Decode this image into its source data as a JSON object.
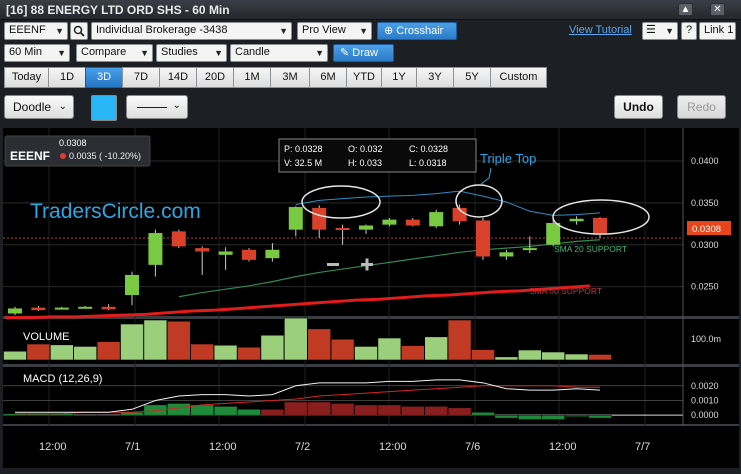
{
  "window": {
    "title": "[16] 88 ENERGY LTD ORD SHS - 60 Min",
    "buttons": [
      "▲",
      "✕"
    ]
  },
  "toolbar1": {
    "symbol": "EEENF",
    "account": "Individual Brokerage -3438",
    "view": "Pro View",
    "crosshair_label": "Crosshair",
    "tutorial_link": "View Tutorial",
    "help_label": "?",
    "link_label": "Link 1"
  },
  "toolbar2": {
    "interval": "60 Min",
    "compare": "Compare",
    "studies": "Studies",
    "chart_type": "Candle",
    "draw_label": "Draw"
  },
  "periods": [
    "Today",
    "1D",
    "3D",
    "7D",
    "14D",
    "20D",
    "1M",
    "3M",
    "6M",
    "YTD",
    "1Y",
    "3Y",
    "5Y",
    "Custom"
  ],
  "active_period": "3D",
  "drawing": {
    "tool": "Doodle",
    "color": "#29b6f6",
    "undo": "Undo",
    "redo": "Redo"
  },
  "quote": {
    "symbol": "EEENF",
    "last": "0.0308",
    "change": "0.0035 ( -10.20%)",
    "change_color": "#e53935"
  },
  "ohlc": {
    "p": "P: 0.0328",
    "o": "O: 0.032",
    "c": "C: 0.0328",
    "v": "V: 32.5 M",
    "h": "H: 0.033",
    "l": "L: 0.0318"
  },
  "annotations": {
    "watermark": "TradersCircle.com",
    "triple_top": "Triple Top",
    "sma20": "SMA 20 SUPPORT",
    "sma50": "SMA 50 SUPPORT",
    "price_tag": "0.0308"
  },
  "panels": {
    "volume_label": "VOLUME",
    "macd_label": "MACD (12,26,9)"
  },
  "chart_data": {
    "type": "candlestick",
    "price_axis": {
      "ticks": [
        "0.0400",
        "0.0350",
        "0.0300",
        "0.0250"
      ],
      "range": [
        0.0215,
        0.0425
      ]
    },
    "time_axis": {
      "ticks": [
        "12:00",
        "7/1",
        "12:00",
        "7/2",
        "12:00",
        "7/6",
        "12:00",
        "7/7"
      ]
    },
    "volume_axis": {
      "ticks": [
        "100.0m"
      ]
    },
    "macd_axis": {
      "ticks": [
        "0.0020",
        "0.0010",
        "0.0000"
      ],
      "range": [
        -0.0006,
        0.0028
      ]
    },
    "candles": [
      {
        "o": 0.0218,
        "h": 0.0226,
        "l": 0.0216,
        "c": 0.0224
      },
      {
        "o": 0.0225,
        "h": 0.0227,
        "l": 0.0221,
        "c": 0.0222
      },
      {
        "o": 0.0224,
        "h": 0.0226,
        "l": 0.0223,
        "c": 0.0225
      },
      {
        "o": 0.0225,
        "h": 0.0227,
        "l": 0.0224,
        "c": 0.0226
      },
      {
        "o": 0.0226,
        "h": 0.0229,
        "l": 0.0222,
        "c": 0.0223
      },
      {
        "o": 0.024,
        "h": 0.0268,
        "l": 0.0228,
        "c": 0.0264
      },
      {
        "o": 0.0276,
        "h": 0.0318,
        "l": 0.0262,
        "c": 0.0314
      },
      {
        "o": 0.0316,
        "h": 0.0318,
        "l": 0.0296,
        "c": 0.0298
      },
      {
        "o": 0.0296,
        "h": 0.0298,
        "l": 0.0264,
        "c": 0.0292
      },
      {
        "o": 0.0288,
        "h": 0.0297,
        "l": 0.027,
        "c": 0.0292
      },
      {
        "o": 0.0294,
        "h": 0.0296,
        "l": 0.028,
        "c": 0.0282
      },
      {
        "o": 0.0284,
        "h": 0.0302,
        "l": 0.028,
        "c": 0.0294
      },
      {
        "o": 0.0318,
        "h": 0.0346,
        "l": 0.031,
        "c": 0.0345
      },
      {
        "o": 0.0344,
        "h": 0.0347,
        "l": 0.0308,
        "c": 0.0318
      },
      {
        "o": 0.032,
        "h": 0.0324,
        "l": 0.03,
        "c": 0.0318
      },
      {
        "o": 0.0318,
        "h": 0.0324,
        "l": 0.0313,
        "c": 0.0323
      },
      {
        "o": 0.0324,
        "h": 0.0332,
        "l": 0.0322,
        "c": 0.033
      },
      {
        "o": 0.033,
        "h": 0.0332,
        "l": 0.0322,
        "c": 0.0323
      },
      {
        "o": 0.0322,
        "h": 0.0342,
        "l": 0.032,
        "c": 0.0339
      },
      {
        "o": 0.0344,
        "h": 0.0348,
        "l": 0.0324,
        "c": 0.0328
      },
      {
        "o": 0.0329,
        "h": 0.0332,
        "l": 0.0282,
        "c": 0.0286
      },
      {
        "o": 0.0286,
        "h": 0.0294,
        "l": 0.0282,
        "c": 0.0291
      },
      {
        "o": 0.0294,
        "h": 0.031,
        "l": 0.029,
        "c": 0.0296
      },
      {
        "o": 0.03,
        "h": 0.0332,
        "l": 0.0298,
        "c": 0.0326
      },
      {
        "o": 0.0328,
        "h": 0.0334,
        "l": 0.0324,
        "c": 0.0331
      },
      {
        "o": 0.0332,
        "h": 0.0333,
        "l": 0.0308,
        "c": 0.0312
      }
    ],
    "volume": [
      {
        "v": 0.22,
        "up": true
      },
      {
        "v": 0.4,
        "up": false
      },
      {
        "v": 0.38,
        "up": true
      },
      {
        "v": 0.34,
        "up": true
      },
      {
        "v": 0.46,
        "up": false
      },
      {
        "v": 0.9,
        "up": true
      },
      {
        "v": 1.0,
        "up": true
      },
      {
        "v": 0.97,
        "up": false
      },
      {
        "v": 0.4,
        "up": false
      },
      {
        "v": 0.37,
        "up": true
      },
      {
        "v": 0.32,
        "up": false
      },
      {
        "v": 0.62,
        "up": true
      },
      {
        "v": 1.05,
        "up": true
      },
      {
        "v": 0.78,
        "up": false
      },
      {
        "v": 0.52,
        "up": false
      },
      {
        "v": 0.34,
        "up": true
      },
      {
        "v": 0.55,
        "up": true
      },
      {
        "v": 0.36,
        "up": false
      },
      {
        "v": 0.58,
        "up": true
      },
      {
        "v": 1.0,
        "up": false
      },
      {
        "v": 0.26,
        "up": false
      },
      {
        "v": 0.08,
        "up": true
      },
      {
        "v": 0.25,
        "up": true
      },
      {
        "v": 0.2,
        "up": true
      },
      {
        "v": 0.15,
        "up": true
      },
      {
        "v": 0.14,
        "up": false
      }
    ],
    "sma20": [
      null,
      null,
      null,
      null,
      null,
      null,
      null,
      0.0238,
      0.0243,
      0.0247,
      0.0251,
      0.0256,
      0.0262,
      0.0267,
      0.0271,
      0.0275,
      0.0279,
      0.0283,
      0.0287,
      0.0291,
      0.0294,
      0.0296,
      0.0298,
      0.0301,
      0.0304,
      0.0306
    ],
    "sma50": [
      0.0213,
      0.0213,
      0.0214,
      0.0214,
      0.0215,
      0.0216,
      0.0217,
      0.0219,
      0.0221,
      0.0222,
      0.0224,
      0.0226,
      0.0228,
      0.023,
      0.0232,
      0.0234,
      0.0235,
      0.0237,
      0.0239,
      0.024,
      0.0242,
      0.0244,
      0.0245,
      0.0247,
      0.0249,
      0.0251
    ],
    "bbands_upper": [
      null,
      null,
      null,
      null,
      null,
      null,
      null,
      null,
      null,
      null,
      null,
      null,
      0.0348,
      0.0353,
      0.0355,
      0.0357,
      0.0358,
      0.0359,
      0.0361,
      0.0364,
      0.0358,
      0.0351,
      0.034,
      0.0335,
      0.0336,
      0.0338
    ],
    "macd": [
      0.0002,
      0.0002,
      0.0002,
      0.0002,
      0.0002,
      0.0004,
      0.001,
      0.0013,
      0.0014,
      0.0014,
      0.0013,
      0.0014,
      0.002,
      0.0022,
      0.0022,
      0.0022,
      0.0023,
      0.0023,
      0.0024,
      0.0024,
      0.0022,
      0.0018,
      0.0017,
      0.0017,
      0.0018,
      0.0017
    ],
    "signal": [
      0.0001,
      0.0001,
      0.0001,
      0.0002,
      0.0002,
      0.0002,
      0.0003,
      0.0005,
      0.0007,
      0.0008,
      0.0009,
      0.001,
      0.0011,
      0.0013,
      0.0014,
      0.0015,
      0.0016,
      0.0017,
      0.0018,
      0.0019,
      0.002,
      0.002,
      0.002,
      0.002,
      0.0019,
      0.0019
    ],
    "histogram": [
      0.0001,
      0.0001,
      0.0001,
      0.0,
      0.0,
      0.0002,
      0.0007,
      0.0008,
      0.0007,
      0.0006,
      0.0004,
      0.0004,
      0.0009,
      0.0009,
      0.0008,
      0.0007,
      0.0007,
      0.0006,
      0.0006,
      0.0005,
      0.0002,
      -0.0002,
      -0.0003,
      -0.0003,
      -0.0001,
      -0.0002
    ]
  }
}
